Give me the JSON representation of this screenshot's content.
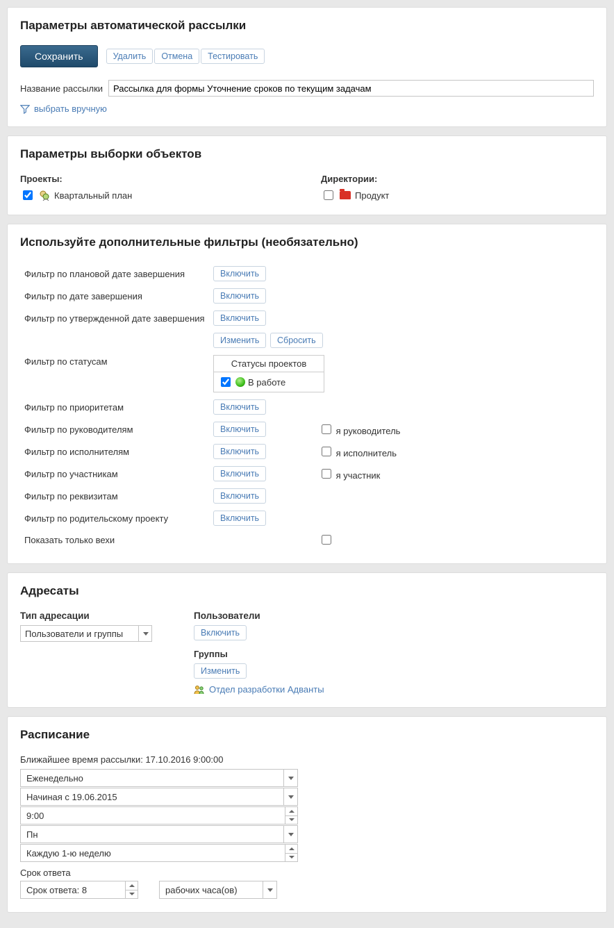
{
  "panel1": {
    "title": "Параметры автоматической рассылки",
    "save": "Сохранить",
    "delete": "Удалить",
    "cancel": "Отмена",
    "test": "Тестировать",
    "name_label": "Название рассылки",
    "name_value": "Рассылка для формы Уточнение сроков по текущим задачам",
    "manual": "выбрать вручную"
  },
  "panel2": {
    "title": "Параметры выборки объектов",
    "projects_label": "Проекты:",
    "project_item": "Квартальный план",
    "directories_label": "Директории:",
    "directory_item": "Продукт"
  },
  "panel3": {
    "title": "Используйте дополнительные фильтры (необязательно)",
    "enable": "Включить",
    "change": "Изменить",
    "reset": "Сбросить",
    "status_header": "Статусы проектов",
    "status_item": "В работе",
    "rows": {
      "r1": "Фильтр по плановой дате завершения",
      "r2": "Фильтр по дате завершения",
      "r3": "Фильтр по утвержденной дате завершения",
      "r4": "Фильтр по статусам",
      "r5": "Фильтр по приоритетам",
      "r6": "Фильтр по руководителям",
      "r7": "Фильтр по исполнителям",
      "r8": "Фильтр по участникам",
      "r9": "Фильтр по реквизитам",
      "r10": "Фильтр по родительскому проекту",
      "r11": "Показать только вехи"
    },
    "me_manager": "я руководитель",
    "me_assignee": "я исполнитель",
    "me_participant": "я участник"
  },
  "panel4": {
    "title": "Адресаты",
    "addressing_type_label": "Тип адресации",
    "addressing_type_value": "Пользователи и группы",
    "users_label": "Пользователи",
    "enable": "Включить",
    "groups_label": "Группы",
    "change": "Изменить",
    "group_item": "Отдел разработки Адванты"
  },
  "panel5": {
    "title": "Расписание",
    "next_time_prefix": "Ближайшее время рассылки: ",
    "next_time_value": "17.10.2016 9:00:00",
    "frequency": "Еженедельно",
    "start": "Начиная с 19.06.2015",
    "time": "9:00",
    "day": "Пн",
    "week": "Каждую 1-ю неделю",
    "deadline_label": "Срок ответа",
    "deadline_value": "Срок ответа: 8",
    "deadline_unit": "рабочих часа(ов)"
  }
}
